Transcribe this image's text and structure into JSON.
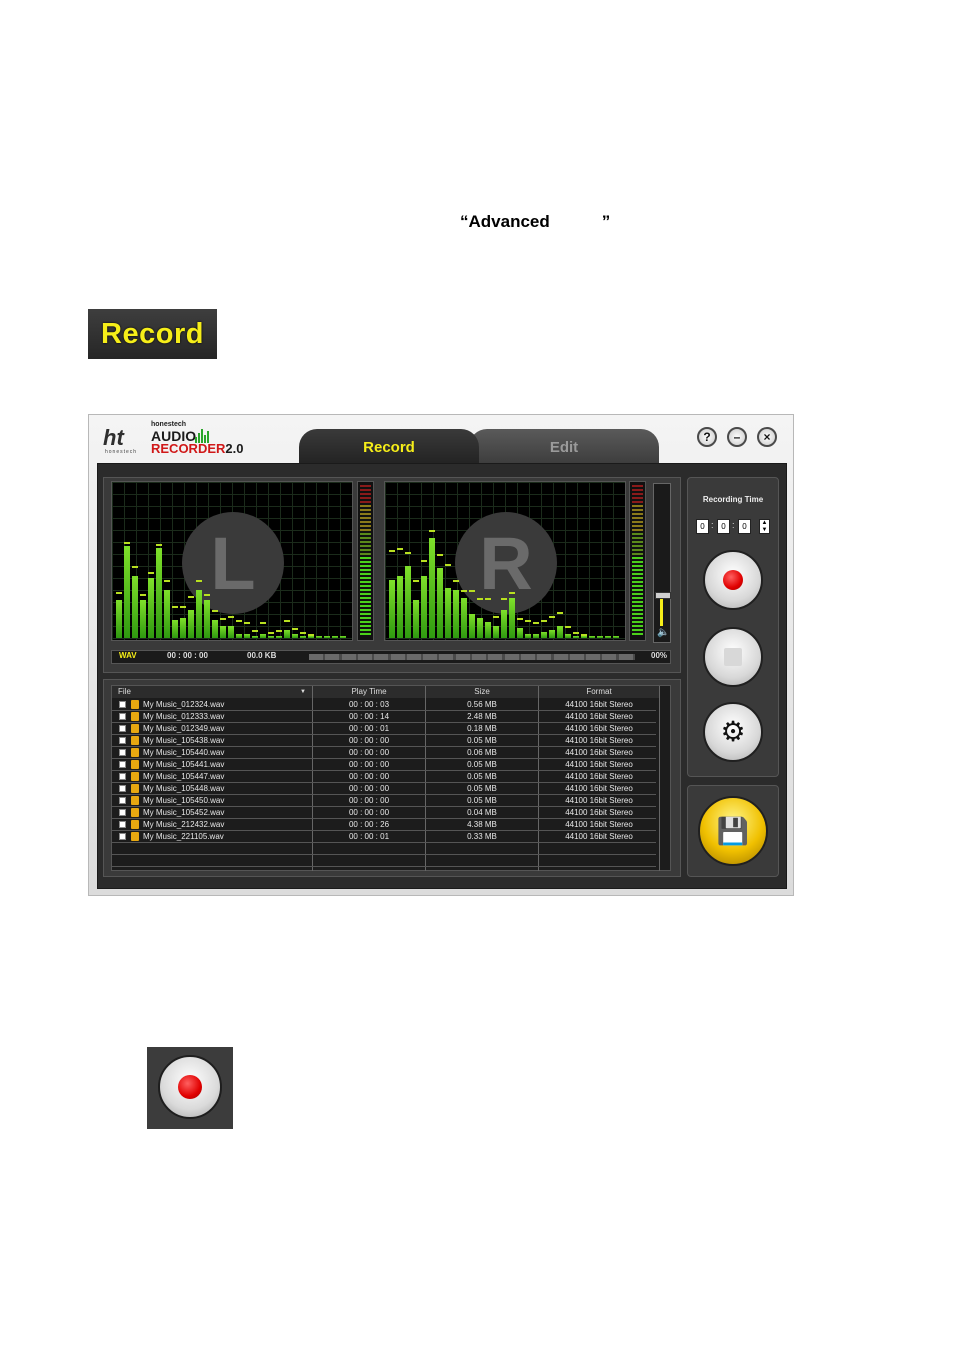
{
  "doc": {
    "advanced_text": "“Advanced",
    "advanced_close": "”",
    "record_label": "Record"
  },
  "app": {
    "logo": {
      "ht": "ht",
      "ht_sub": "honestech",
      "brand": "honestech",
      "audio": "AUDIO",
      "recorder": "RECORDER",
      "version": "2.0"
    },
    "tabs": [
      {
        "label": "Record",
        "active": true
      },
      {
        "label": "Edit",
        "active": false
      }
    ],
    "window_buttons": {
      "help": "?",
      "minimize": "–",
      "close": "×"
    },
    "left_channel": "L",
    "right_channel": "R",
    "status": {
      "format": "WAV",
      "time": "00 : 00 : 00",
      "size": "00.0 KB",
      "percent": "00%"
    },
    "recording_time": {
      "title": "Recording Time",
      "h": "0",
      "m": "0",
      "s": "0"
    },
    "table": {
      "headers": {
        "file": "File",
        "play_time": "Play Time",
        "size": "Size",
        "format": "Format"
      },
      "rows": [
        {
          "file": "My Music_012324.wav",
          "time": "00 : 00 : 03",
          "size": "0.56 MB",
          "format": "44100 16bit Stereo"
        },
        {
          "file": "My Music_012333.wav",
          "time": "00 : 00 : 14",
          "size": "2.48 MB",
          "format": "44100 16bit Stereo"
        },
        {
          "file": "My Music_012349.wav",
          "time": "00 : 00 : 01",
          "size": "0.18 MB",
          "format": "44100 16bit Stereo"
        },
        {
          "file": "My Music_105438.wav",
          "time": "00 : 00 : 00",
          "size": "0.05 MB",
          "format": "44100 16bit Stereo"
        },
        {
          "file": "My Music_105440.wav",
          "time": "00 : 00 : 00",
          "size": "0.06 MB",
          "format": "44100 16bit Stereo"
        },
        {
          "file": "My Music_105441.wav",
          "time": "00 : 00 : 00",
          "size": "0.05 MB",
          "format": "44100 16bit Stereo"
        },
        {
          "file": "My Music_105447.wav",
          "time": "00 : 00 : 00",
          "size": "0.05 MB",
          "format": "44100 16bit Stereo"
        },
        {
          "file": "My Music_105448.wav",
          "time": "00 : 00 : 00",
          "size": "0.05 MB",
          "format": "44100 16bit Stereo"
        },
        {
          "file": "My Music_105450.wav",
          "time": "00 : 00 : 00",
          "size": "0.05 MB",
          "format": "44100 16bit Stereo"
        },
        {
          "file": "My Music_105452.wav",
          "time": "00 : 00 : 00",
          "size": "0.04 MB",
          "format": "44100 16bit Stereo"
        },
        {
          "file": "My Music_212432.wav",
          "time": "00 : 00 : 26",
          "size": "4.38 MB",
          "format": "44100 16bit Stereo"
        },
        {
          "file": "My Music_221105.wav",
          "time": "00 : 00 : 01",
          "size": "0.33 MB",
          "format": "44100 16bit Stereo"
        }
      ]
    },
    "icons": {
      "record": "record-icon",
      "stop": "stop-icon",
      "settings": "gear-icon",
      "save": "save-icon",
      "speaker": "speaker-icon"
    },
    "colors": {
      "accent_yellow": "#f6ee19",
      "record_red": "#e00000",
      "meter_green": "#5cc81e"
    }
  }
}
